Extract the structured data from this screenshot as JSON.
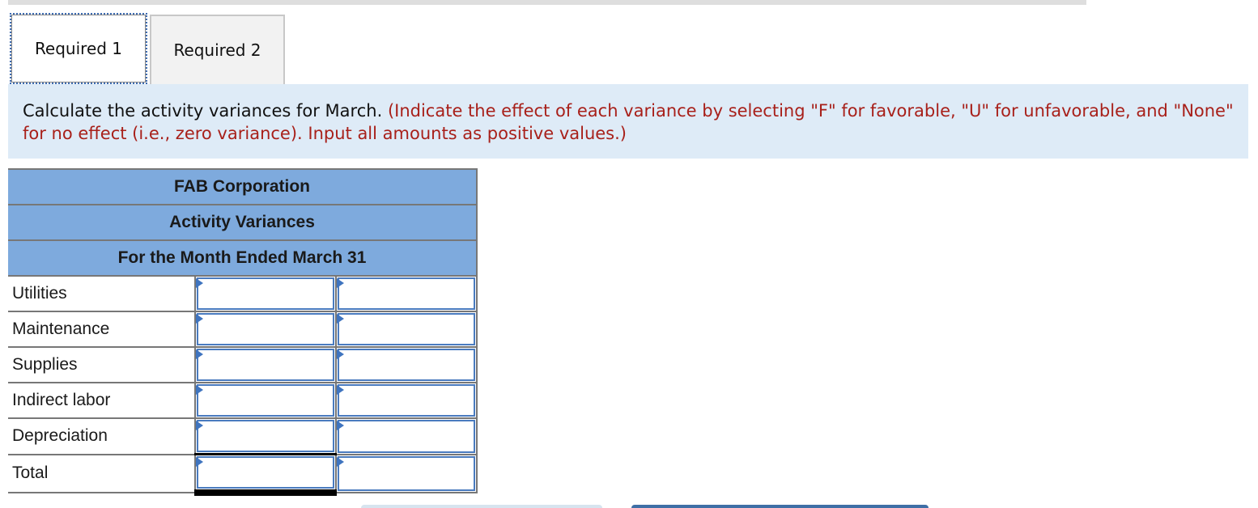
{
  "tabs": [
    {
      "label": "Required 1",
      "active": true
    },
    {
      "label": "Required 2",
      "active": false
    }
  ],
  "instructions": {
    "main": "Calculate the activity variances for March.",
    "note": "(Indicate the effect of each variance by selecting \"F\" for favorable, \"U\" for unfavorable, and \"None\" for no effect (i.e., zero variance). Input all amounts as positive values.)"
  },
  "statement": {
    "company": "FAB Corporation",
    "title": "Activity Variances",
    "period": "For the Month Ended March 31",
    "rows": [
      {
        "label": "Utilities",
        "amount": "",
        "effect": ""
      },
      {
        "label": "Maintenance",
        "amount": "",
        "effect": ""
      },
      {
        "label": "Supplies",
        "amount": "",
        "effect": ""
      },
      {
        "label": "Indirect labor",
        "amount": "",
        "effect": ""
      },
      {
        "label": "Depreciation",
        "amount": "",
        "effect": ""
      },
      {
        "label": "Total",
        "amount": "",
        "effect": ""
      }
    ]
  },
  "colors": {
    "header_fill": "#7eaadd",
    "instruction_bg": "#deebf7",
    "note_text": "#a8201a",
    "input_border": "#4a7bbf"
  }
}
